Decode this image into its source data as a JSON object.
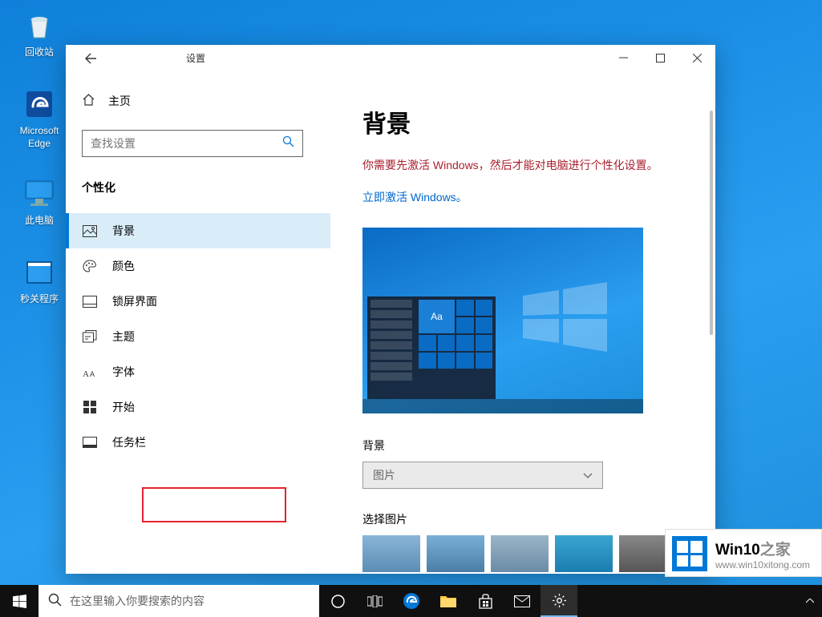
{
  "desktop_icons": {
    "recycle": "回收站",
    "edge": "Microsoft\nEdge",
    "this_pc": "此电脑",
    "sec_close": "秒关程序"
  },
  "window": {
    "title": "设置",
    "home": "主页",
    "search_placeholder": "查找设置",
    "section": "个性化",
    "nav": {
      "background": "背景",
      "colors": "颜色",
      "lockscreen": "锁屏界面",
      "themes": "主题",
      "fonts": "字体",
      "start": "开始",
      "taskbar": "任务栏"
    },
    "content": {
      "heading": "背景",
      "warning": "你需要先激活 Windows，然后才能对电脑进行个性化设置。",
      "activate_link": "立即激活 Windows。",
      "preview_aa": "Aa",
      "bg_label": "背景",
      "bg_dropdown": "图片",
      "choose_pic": "选择图片"
    }
  },
  "taskbar": {
    "search_placeholder": "在这里输入你要搜索的内容"
  },
  "watermark": {
    "brand_main": "Win10",
    "brand_suffix": "之家",
    "url": "www.win10xitong.com"
  }
}
